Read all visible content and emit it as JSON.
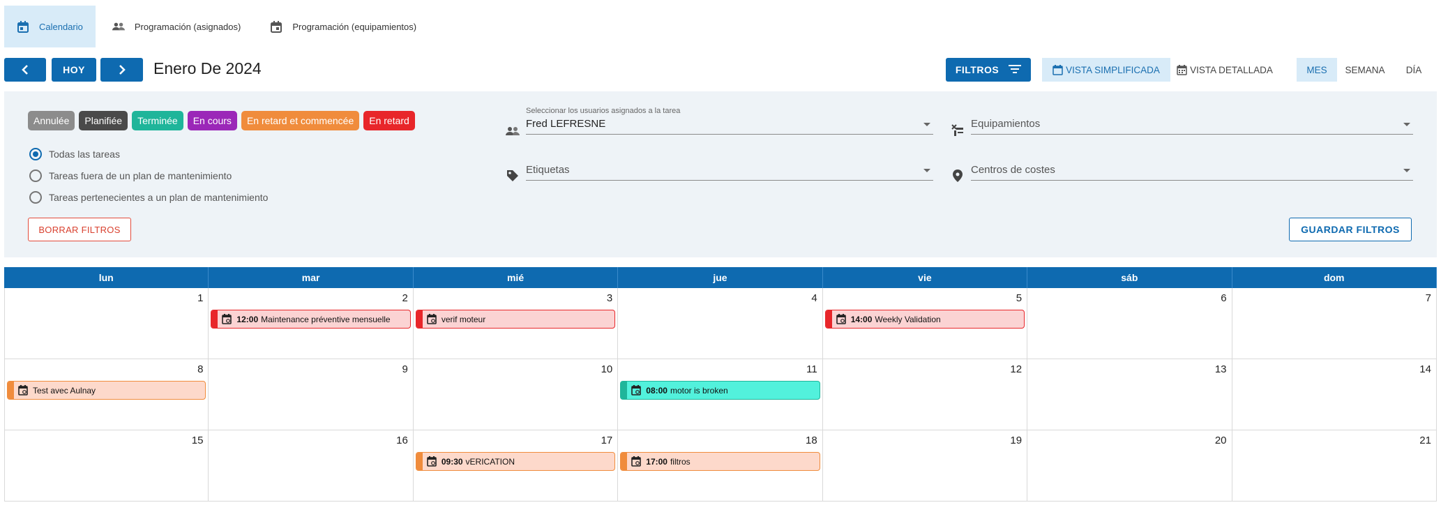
{
  "tabs": [
    {
      "label": "Calendario",
      "icon": "calendar-icon",
      "active": true
    },
    {
      "label": "Programación (asignados)",
      "icon": "people-icon",
      "active": false
    },
    {
      "label": "Programación (equipamientos)",
      "icon": "calendar-icon",
      "active": false
    }
  ],
  "toolbar": {
    "prev_icon": "chevron-left-icon",
    "today_label": "HOY",
    "next_icon": "chevron-right-icon",
    "period_title": "Enero De 2024",
    "filters_label": "FILTROS",
    "simple_view_label": "VISTA SIMPLIFICADA",
    "detailed_view_label": "VISTA DETALLADA",
    "views": [
      "MES",
      "SEMANA",
      "DÍA"
    ],
    "active_view": "MES"
  },
  "filters": {
    "status_chips": [
      {
        "label": "Annulée",
        "color": "#8c8c8c"
      },
      {
        "label": "Planifiée",
        "color": "#4a4a4a"
      },
      {
        "label": "Terminée",
        "color": "#1fb59a"
      },
      {
        "label": "En cours",
        "color": "#9b27b8"
      },
      {
        "label": "En retard et commencée",
        "color": "#f08c3c"
      },
      {
        "label": "En retard",
        "color": "#e8262a"
      }
    ],
    "task_scope": [
      {
        "label": "Todas las tareas",
        "checked": true
      },
      {
        "label": "Tareas fuera de un plan de mantenimiento",
        "checked": false
      },
      {
        "label": "Tareas pertenecientes a un plan de mantenimiento",
        "checked": false
      }
    ],
    "users": {
      "label": "Seleccionar los usuarios asignados a la tarea",
      "value": "Fred LEFRESNE"
    },
    "equipment": {
      "placeholder": "Equipamientos"
    },
    "tags": {
      "placeholder": "Etiquetas"
    },
    "cost_centers": {
      "placeholder": "Centros de costes"
    },
    "clear_label": "BORRAR FILTROS",
    "save_label": "GUARDAR FILTROS"
  },
  "calendar": {
    "weekdays": [
      "lun",
      "mar",
      "mié",
      "jue",
      "vie",
      "sáb",
      "dom"
    ],
    "weeks": [
      {
        "days": [
          "1",
          "2",
          "3",
          "4",
          "5",
          "6",
          "7"
        ]
      },
      {
        "days": [
          "8",
          "9",
          "10",
          "11",
          "12",
          "13",
          "14"
        ]
      },
      {
        "days": [
          "15",
          "16",
          "17",
          "18",
          "19",
          "20",
          "21"
        ]
      }
    ],
    "events": [
      {
        "week": 0,
        "day": 1,
        "time": "12:00",
        "title": "Maintenance préventive mensuelle",
        "status_color": "#e8262a",
        "bg": "#fbd3d3"
      },
      {
        "week": 0,
        "day": 2,
        "time": "",
        "title": "verif moteur",
        "status_color": "#e8262a",
        "bg": "#fbd3d3"
      },
      {
        "week": 0,
        "day": 4,
        "time": "14:00",
        "title": "Weekly Validation",
        "status_color": "#e8262a",
        "bg": "#fbd3d3"
      },
      {
        "week": 1,
        "day": 0,
        "time": "",
        "title": "Test avec Aulnay",
        "status_color": "#f08c3c",
        "bg": "#fdd9cb"
      },
      {
        "week": 1,
        "day": 3,
        "time": "08:00",
        "title": "motor is broken",
        "status_color": "#1fb59a",
        "bg": "#52f1dc"
      },
      {
        "week": 2,
        "day": 2,
        "time": "09:30",
        "title": "vERICATION",
        "status_color": "#f08c3c",
        "bg": "#fdd9cb"
      },
      {
        "week": 2,
        "day": 3,
        "time": "17:00",
        "title": "filtros",
        "status_color": "#f08c3c",
        "bg": "#fdd9cb"
      }
    ]
  }
}
